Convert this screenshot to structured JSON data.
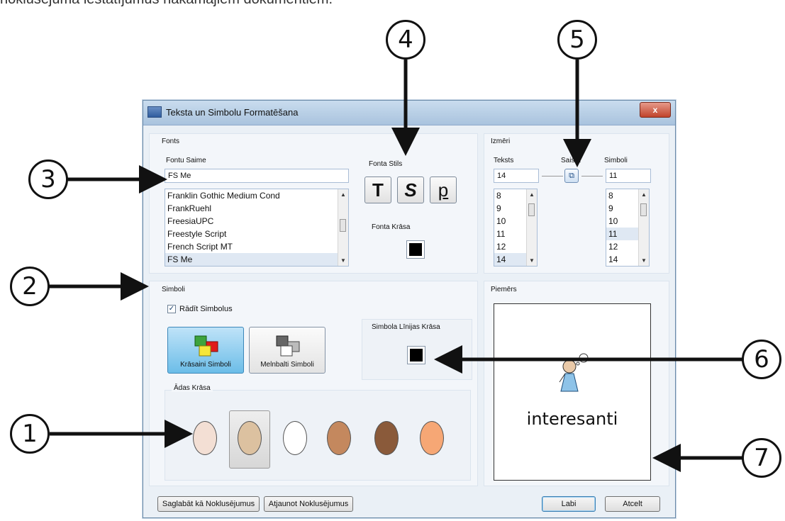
{
  "intro_text": "noklusējuma iestatījumus nākamajiem dokumentiem.",
  "callouts": [
    "1",
    "2",
    "3",
    "4",
    "5",
    "6",
    "7"
  ],
  "dialog": {
    "title": "Teksta un Simbolu Formatēšana",
    "close_label": "x",
    "fonts": {
      "group_label": "Fonts",
      "family_label": "Fontu Saime",
      "family_value": "FS Me",
      "family_list": [
        "Franklin Gothic Medium Cond",
        "FrankRuehl",
        "FreesiaUPC",
        "Freestyle Script",
        "French Script MT",
        "FS Me"
      ],
      "style_label": "Fonta Stils",
      "style_buttons": [
        "T",
        "S",
        "p"
      ],
      "color_label": "Fonta Krāsa"
    },
    "sizes": {
      "group_label": "Izmēri",
      "text_label": "Teksts",
      "link_label": "Saistīt",
      "symbols_label": "Simboli",
      "text_value": "14",
      "symbols_value": "11",
      "text_list": [
        "8",
        "9",
        "10",
        "11",
        "12",
        "14"
      ],
      "symbols_list": [
        "8",
        "9",
        "10",
        "11",
        "12",
        "14"
      ]
    },
    "symbols": {
      "group_label": "Simboli",
      "show_label": "Rādīt Simbolus",
      "show_checked": true,
      "color_symbols_label": "Krāsaini Simboli",
      "bw_symbols_label": "Melnbalti Simboli",
      "line_color_label": "Simbola Līnijas Krāsa",
      "skin_label": "Ādas Krāsa",
      "skin_colors": [
        "#f3dfd4",
        "#dcc1a0",
        "#ffffff",
        "#c4885e",
        "#8a5a3a",
        "#f6a775"
      ],
      "selected_skin_index": 1
    },
    "preview": {
      "group_label": "Piemērs",
      "word": "interesanti"
    },
    "footer": {
      "save_default": "Saglabāt kā Noklusējumus",
      "restore_default": "Atjaunot Noklusējumus",
      "ok": "Labi",
      "cancel": "Atcelt"
    }
  }
}
